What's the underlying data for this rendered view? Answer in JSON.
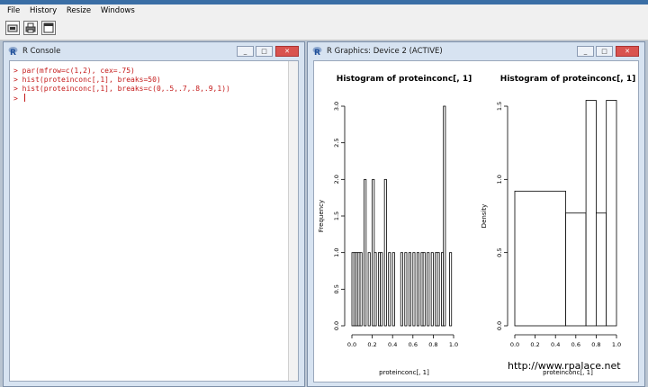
{
  "menu": {
    "items": [
      "File",
      "History",
      "Resize",
      "Windows"
    ]
  },
  "toolbar": {
    "buttons": [
      "open-script-icon",
      "print-icon",
      "window-icon"
    ]
  },
  "console": {
    "title": "R Console",
    "lines": [
      "> par(mfrow=c(1,2), cex=.75)",
      "> hist(proteinconc[,1], breaks=50)",
      "> hist(proteinconc[,1], breaks=c(0,.5,.7,.8,.9,1))",
      "> "
    ]
  },
  "graphics": {
    "title": "R Graphics: Device 2 (ACTIVE)"
  },
  "window_buttons": {
    "minimize": "_",
    "maximize": "□",
    "close": "✕"
  },
  "watermark": "http://www.rpalace.net",
  "chart_data": [
    {
      "type": "bar",
      "title": "Histogram of proteinconc[, 1]",
      "xlabel": "proteinconc[, 1]",
      "ylabel": "Frequency",
      "xlim": [
        0,
        1
      ],
      "ylim": [
        0,
        3
      ],
      "xticks": [
        "0.0",
        "0.2",
        "0.4",
        "0.6",
        "0.8",
        "1.0"
      ],
      "yticks": [
        "0.0",
        "0.5",
        "1.0",
        "1.5",
        "2.0",
        "2.5",
        "3.0"
      ],
      "bin_width": 0.02,
      "bins": [
        {
          "x": 0.0,
          "count": 1
        },
        {
          "x": 0.02,
          "count": 1
        },
        {
          "x": 0.04,
          "count": 1
        },
        {
          "x": 0.06,
          "count": 1
        },
        {
          "x": 0.08,
          "count": 1
        },
        {
          "x": 0.12,
          "count": 2
        },
        {
          "x": 0.16,
          "count": 1
        },
        {
          "x": 0.2,
          "count": 2
        },
        {
          "x": 0.22,
          "count": 1
        },
        {
          "x": 0.26,
          "count": 1
        },
        {
          "x": 0.28,
          "count": 1
        },
        {
          "x": 0.32,
          "count": 2
        },
        {
          "x": 0.36,
          "count": 1
        },
        {
          "x": 0.4,
          "count": 1
        },
        {
          "x": 0.48,
          "count": 1
        },
        {
          "x": 0.52,
          "count": 1
        },
        {
          "x": 0.56,
          "count": 1
        },
        {
          "x": 0.6,
          "count": 1
        },
        {
          "x": 0.64,
          "count": 1
        },
        {
          "x": 0.68,
          "count": 1
        },
        {
          "x": 0.7,
          "count": 1
        },
        {
          "x": 0.74,
          "count": 1
        },
        {
          "x": 0.78,
          "count": 1
        },
        {
          "x": 0.82,
          "count": 1
        },
        {
          "x": 0.84,
          "count": 1
        },
        {
          "x": 0.88,
          "count": 1
        },
        {
          "x": 0.9,
          "count": 3
        },
        {
          "x": 0.96,
          "count": 1
        }
      ]
    },
    {
      "type": "bar",
      "title": "Histogram of proteinconc[, 1]",
      "xlabel": "proteinconc[, 1]",
      "ylabel": "Density",
      "xlim": [
        0,
        1
      ],
      "ylim": [
        0,
        1.5
      ],
      "xticks": [
        "0.0",
        "0.2",
        "0.4",
        "0.6",
        "0.8",
        "1.0"
      ],
      "yticks": [
        "0.0",
        "0.5",
        "1.0",
        "1.5"
      ],
      "bins": [
        {
          "from": 0.0,
          "to": 0.5,
          "density": 0.92
        },
        {
          "from": 0.5,
          "to": 0.7,
          "density": 0.77
        },
        {
          "from": 0.7,
          "to": 0.8,
          "density": 1.54
        },
        {
          "from": 0.8,
          "to": 0.9,
          "density": 0.77
        },
        {
          "from": 0.9,
          "to": 1.0,
          "density": 1.54
        }
      ]
    }
  ]
}
